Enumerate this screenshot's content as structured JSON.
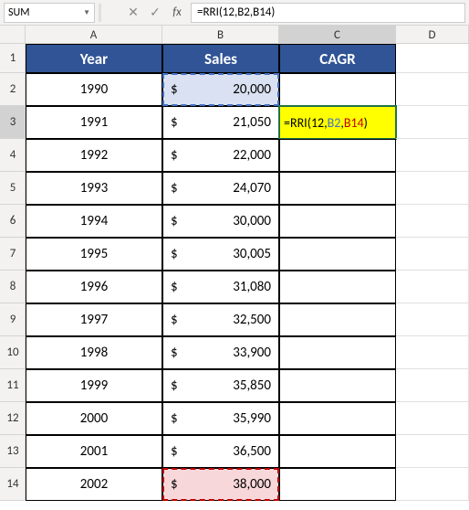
{
  "name_box": "SUM",
  "formula": "=RRI(12,B2,B14)",
  "formula_parts": {
    "prefix": "=RRI(12,",
    "ref1": "B2",
    "sep": ",",
    "ref2": "B14",
    "suffix": ")"
  },
  "columns": [
    "A",
    "B",
    "C",
    "D"
  ],
  "rows": [
    "1",
    "2",
    "3",
    "4",
    "5",
    "6",
    "7",
    "8",
    "9",
    "10",
    "11",
    "12",
    "13",
    "14"
  ],
  "active_col": "C",
  "active_row": "3",
  "headers": {
    "A": "Year",
    "B": "Sales",
    "C": "CAGR"
  },
  "currency": "$",
  "table": [
    {
      "year": "1990",
      "sales": "20,000",
      "cagr": ""
    },
    {
      "year": "1991",
      "sales": "21,050",
      "cagr": "=RRI(12,B2,B14)"
    },
    {
      "year": "1992",
      "sales": "22,000",
      "cagr": ""
    },
    {
      "year": "1993",
      "sales": "24,070",
      "cagr": ""
    },
    {
      "year": "1994",
      "sales": "30,000",
      "cagr": ""
    },
    {
      "year": "1995",
      "sales": "30,005",
      "cagr": ""
    },
    {
      "year": "1996",
      "sales": "31,080",
      "cagr": ""
    },
    {
      "year": "1997",
      "sales": "32,500",
      "cagr": ""
    },
    {
      "year": "1998",
      "sales": "33,900",
      "cagr": ""
    },
    {
      "year": "1999",
      "sales": "35,850",
      "cagr": ""
    },
    {
      "year": "2000",
      "sales": "35,990",
      "cagr": ""
    },
    {
      "year": "2001",
      "sales": "36,500",
      "cagr": ""
    },
    {
      "year": "2002",
      "sales": "38,000",
      "cagr": ""
    }
  ],
  "ref_cells": {
    "b2_row": 0,
    "b14_row": 12
  },
  "icons": {
    "cancel": "✕",
    "enter": "✓",
    "fx": "fx",
    "dropdown": "▼"
  }
}
